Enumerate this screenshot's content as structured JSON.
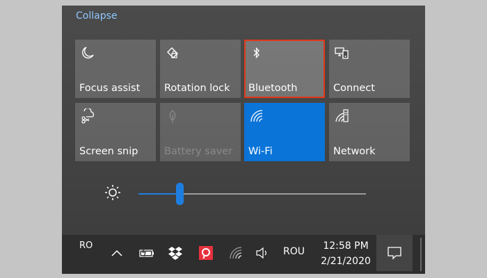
{
  "panel": {
    "collapse_label": "Collapse",
    "tiles": [
      {
        "label": "Focus assist",
        "icon": "moon-icon",
        "state": "normal"
      },
      {
        "label": "Rotation lock",
        "icon": "rotation-lock-icon",
        "state": "normal"
      },
      {
        "label": "Bluetooth",
        "icon": "bluetooth-icon",
        "state": "selected"
      },
      {
        "label": "Connect",
        "icon": "connect-icon",
        "state": "normal"
      },
      {
        "label": "Screen snip",
        "icon": "screen-snip-icon",
        "state": "normal"
      },
      {
        "label": "Battery saver",
        "icon": "leaf-icon",
        "state": "disabled"
      },
      {
        "label": "Wi-Fi",
        "icon": "wifi-icon",
        "state": "active"
      },
      {
        "label": "Network",
        "icon": "network-icon",
        "state": "normal"
      }
    ],
    "brightness": {
      "icon": "sun-icon",
      "level": 0.18
    }
  },
  "taskbar": {
    "language_short": "RO",
    "language": "ROU",
    "time": "12:58 PM",
    "date": "2/21/2020",
    "icons": [
      "chevron-up-icon",
      "battery-icon",
      "dropbox-icon",
      "pin-app-icon",
      "wifi-icon",
      "volume-icon",
      "notification-icon"
    ]
  },
  "colors": {
    "accent": "#0b74d8",
    "selection_outline": "#e2381a",
    "link": "#8fc6ff"
  }
}
